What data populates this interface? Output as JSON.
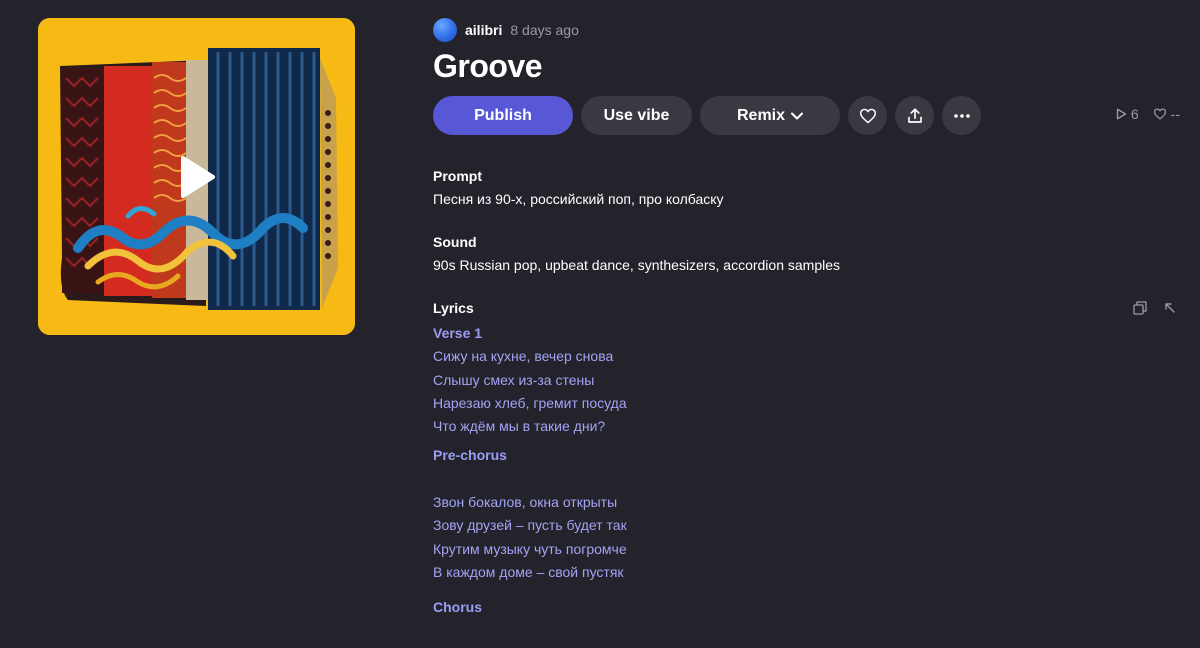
{
  "song": {
    "author": "ailibri",
    "posted": "8 days ago",
    "title": "Groove"
  },
  "actions": {
    "publish": "Publish",
    "use_vibe": "Use vibe",
    "remix": "Remix"
  },
  "stats": {
    "plays": "6",
    "likes": "--"
  },
  "prompt": {
    "label": "Prompt",
    "text": "Песня из 90-х, российский поп, про колбаску"
  },
  "sound": {
    "label": "Sound",
    "text": "90s Russian pop, upbeat dance, synthesizers, accordion samples"
  },
  "lyrics": {
    "label": "Lyrics",
    "lines": [
      "Verse 1",
      "Сижу на кухне, вечер снова",
      "Слышу смех из-за стены",
      "Нарезаю хлеб, гремит посуда",
      "Что ждём мы в такие дни?",
      "Pre-chorus",
      "",
      "Звон бокалов, окна открыты",
      "Зову друзей – пусть будет так",
      "Крутим музыку чуть погромче",
      "В каждом доме – свой пустяк",
      "Chorus"
    ]
  },
  "icons": {
    "play": "play-icon",
    "like": "heart-icon",
    "share": "share-icon",
    "more": "more-icon",
    "copy": "copy-icon",
    "collapse": "collapse-icon"
  },
  "colors": {
    "background": "#24232b",
    "accent": "#5858d6",
    "button": "#3a3942",
    "lyrics": "#a3a3f5",
    "cover_bg": "#f7b914"
  }
}
